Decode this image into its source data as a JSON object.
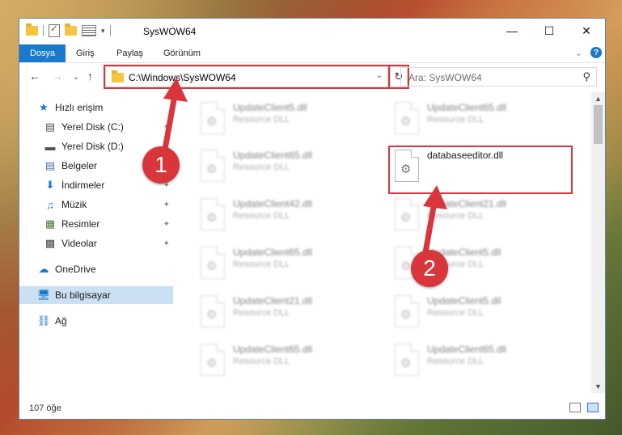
{
  "window": {
    "title": "SysWOW64"
  },
  "ribbon": {
    "tabs": [
      "Dosya",
      "Giriş",
      "Paylaş",
      "Görünüm"
    ]
  },
  "nav": {
    "address": "C:\\Windows\\SysWOW64",
    "search_placeholder": "Ara: SysWOW64"
  },
  "sidebar": {
    "items": [
      {
        "label": "Hızlı erişim"
      },
      {
        "label": "Yerel Disk (C:)"
      },
      {
        "label": "Yerel Disk (D:)"
      },
      {
        "label": "Belgeler"
      },
      {
        "label": "İndirmeler"
      },
      {
        "label": "Müzik"
      },
      {
        "label": "Resimler"
      },
      {
        "label": "Videolar"
      },
      {
        "label": "OneDrive"
      },
      {
        "label": "Bu bilgisayar"
      },
      {
        "label": "Ağ"
      }
    ]
  },
  "files": [
    {
      "name": "UpdateClient5.dll",
      "type": "Resource DLL"
    },
    {
      "name": "UpdateClient65.dll",
      "type": "Resource DLL"
    },
    {
      "name": "UpdateClient65.dll",
      "type": "Resource DLL"
    },
    {
      "name": "databaseeditor.dll",
      "type": ""
    },
    {
      "name": "UpdateClient42.dll",
      "type": "Resource DLL"
    },
    {
      "name": "UpdateClient21.dll",
      "type": "Resource DLL"
    },
    {
      "name": "UpdateClient65.dll",
      "type": "Resource DLL"
    },
    {
      "name": "UpdateClient5.dll",
      "type": "Resource DLL"
    },
    {
      "name": "UpdateClient21.dll",
      "type": "Resource DLL"
    },
    {
      "name": "UpdateClient5.dll",
      "type": "Resource DLL"
    },
    {
      "name": "UpdateClient65.dll",
      "type": "Resource DLL"
    },
    {
      "name": "UpdateClient65.dll",
      "type": "Resource DLL"
    }
  ],
  "status": {
    "count": "107 öğe"
  },
  "annotations": {
    "step1": "1",
    "step2": "2"
  },
  "colors": {
    "accent": "#1979ca",
    "highlight": "#d9363b"
  }
}
